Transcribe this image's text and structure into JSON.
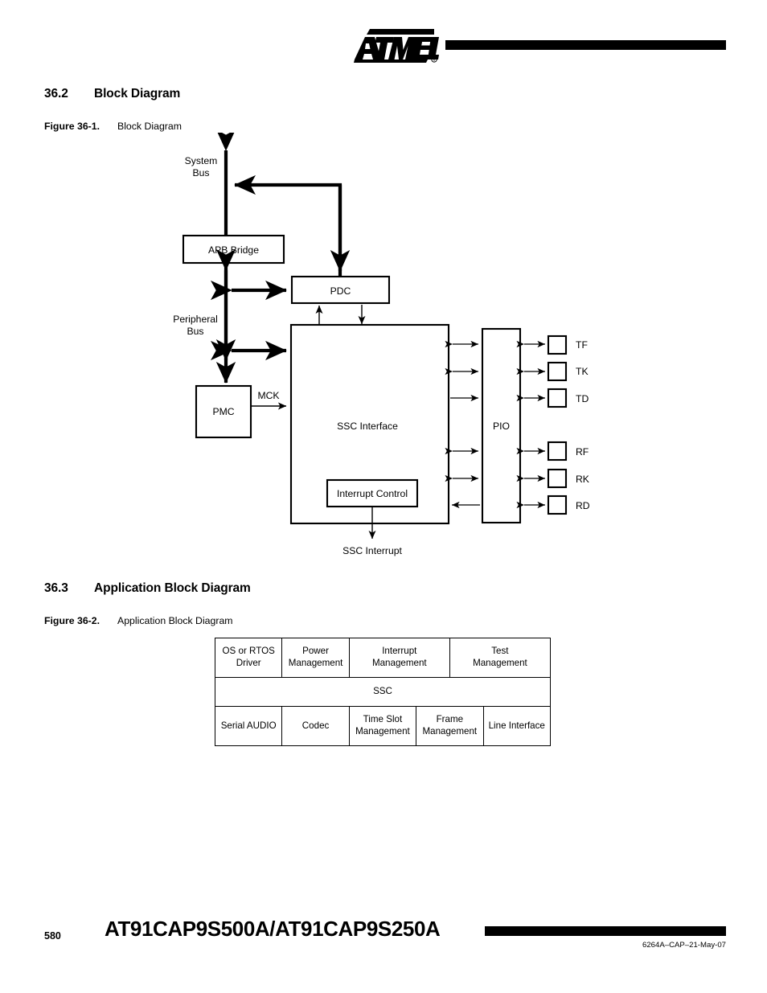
{
  "header": {
    "logo_text": "ATMEL",
    "logo_icon": "atmel-logo"
  },
  "sections": {
    "block_diagram": {
      "number": "36.2",
      "title": "Block Diagram",
      "figure_label": "Figure 36-1.",
      "figure_title": "Block Diagram"
    },
    "application_block_diagram": {
      "number": "36.3",
      "title": "Application Block Diagram",
      "figure_label": "Figure 36-2.",
      "figure_title": "Application Block Diagram"
    }
  },
  "figure_1": {
    "blocks": {
      "apb_bridge": "APB Bridge",
      "pdc": "PDC",
      "pmc": "PMC",
      "ssc_interface": "SSC Interface",
      "interrupt_control": "Interrupt Control",
      "pio": "PIO"
    },
    "labels": {
      "system_bus_line1": "System",
      "system_bus_line2": "Bus",
      "peripheral_bus_line1": "Peripheral",
      "peripheral_bus_line2": "Bus",
      "mck": "MCK",
      "ssc_interrupt": "SSC Interrupt"
    },
    "pads": [
      {
        "name": "TF",
        "group": "transmit"
      },
      {
        "name": "TK",
        "group": "transmit"
      },
      {
        "name": "TD",
        "group": "transmit"
      },
      {
        "name": "RF",
        "group": "receive"
      },
      {
        "name": "RK",
        "group": "receive"
      },
      {
        "name": "RD",
        "group": "receive"
      }
    ]
  },
  "figure_2": {
    "rows": [
      {
        "cells": [
          {
            "text": "OS or RTOS Driver"
          },
          {
            "text": "Power\nManagement"
          },
          {
            "text": "Interrupt\nManagement"
          },
          {
            "text": "Test\nManagement"
          }
        ]
      },
      {
        "cells": [
          {
            "text": "SSC"
          }
        ]
      },
      {
        "cells": [
          {
            "text": "Serial AUDIO"
          },
          {
            "text": "Codec"
          },
          {
            "text": "Time Slot\nManagement"
          },
          {
            "text": "Frame\nManagement"
          },
          {
            "text": "Line Interface"
          }
        ]
      }
    ]
  },
  "footer": {
    "page_number": "580",
    "document_title": "AT91CAP9S500A/AT91CAP9S250A",
    "document_id": "6264A–CAP–21-May-07"
  }
}
